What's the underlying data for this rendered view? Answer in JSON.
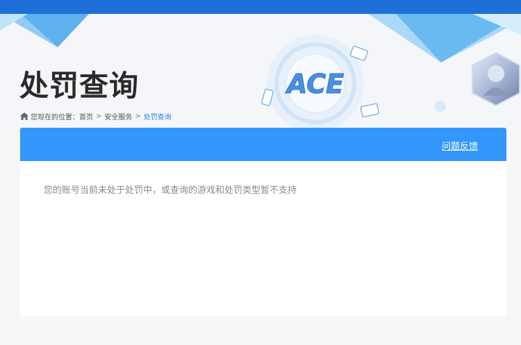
{
  "page": {
    "title": "处罚查询"
  },
  "breadcrumb": {
    "icon": "home-icon",
    "prefix": "您现在的位置：",
    "items": [
      "首页",
      "安全服务",
      "处罚查询"
    ],
    "separator": ">"
  },
  "banner": {
    "badge_text": "ACE"
  },
  "panel": {
    "feedback_label": "问题反馈",
    "message": "您的账号当前未处于处罚中，或查询的游戏和处罚类型暂不支持"
  },
  "colors": {
    "top_bar": "#1e6fd8",
    "panel_header": "#3296fa",
    "breadcrumb_current": "#2e86de",
    "page_background": "#f5f6f8"
  }
}
